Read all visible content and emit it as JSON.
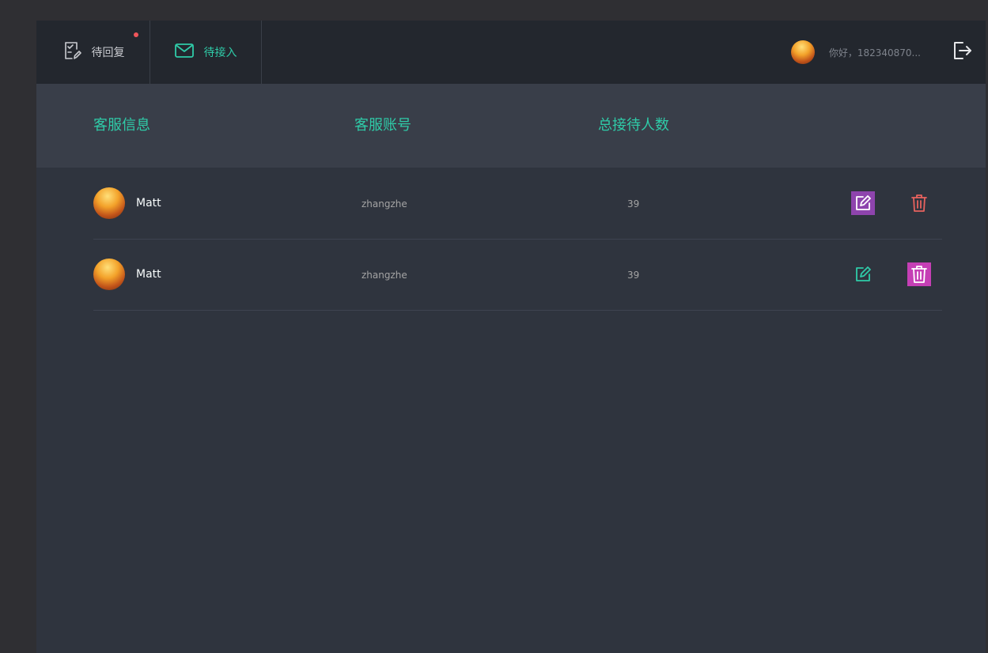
{
  "topbar": {
    "tabs": [
      {
        "label": "待回复",
        "icon": "pending-reply-icon",
        "has_dot": true,
        "active": false
      },
      {
        "label": "待接入",
        "icon": "mail-icon",
        "active": true
      }
    ],
    "greeting": "你好，182340870...",
    "logout_icon": "logout-icon"
  },
  "table": {
    "columns": [
      "客服信息",
      "客服账号",
      "总接待人数"
    ],
    "rows": [
      {
        "name": "Matt",
        "account": "zhangzhe",
        "total": "39"
      },
      {
        "name": "Matt",
        "account": "zhangzhe",
        "total": "39"
      }
    ]
  },
  "colors": {
    "accent": "#2fcba8",
    "name_text": "#f8fcfc",
    "meta_text": "#a4a4a4",
    "delete": "#e8625e",
    "notice_dot": "#f0555a",
    "topbar_bg": "#23272e",
    "header_bg": "#393e49",
    "body_bg": "#2f343e"
  }
}
